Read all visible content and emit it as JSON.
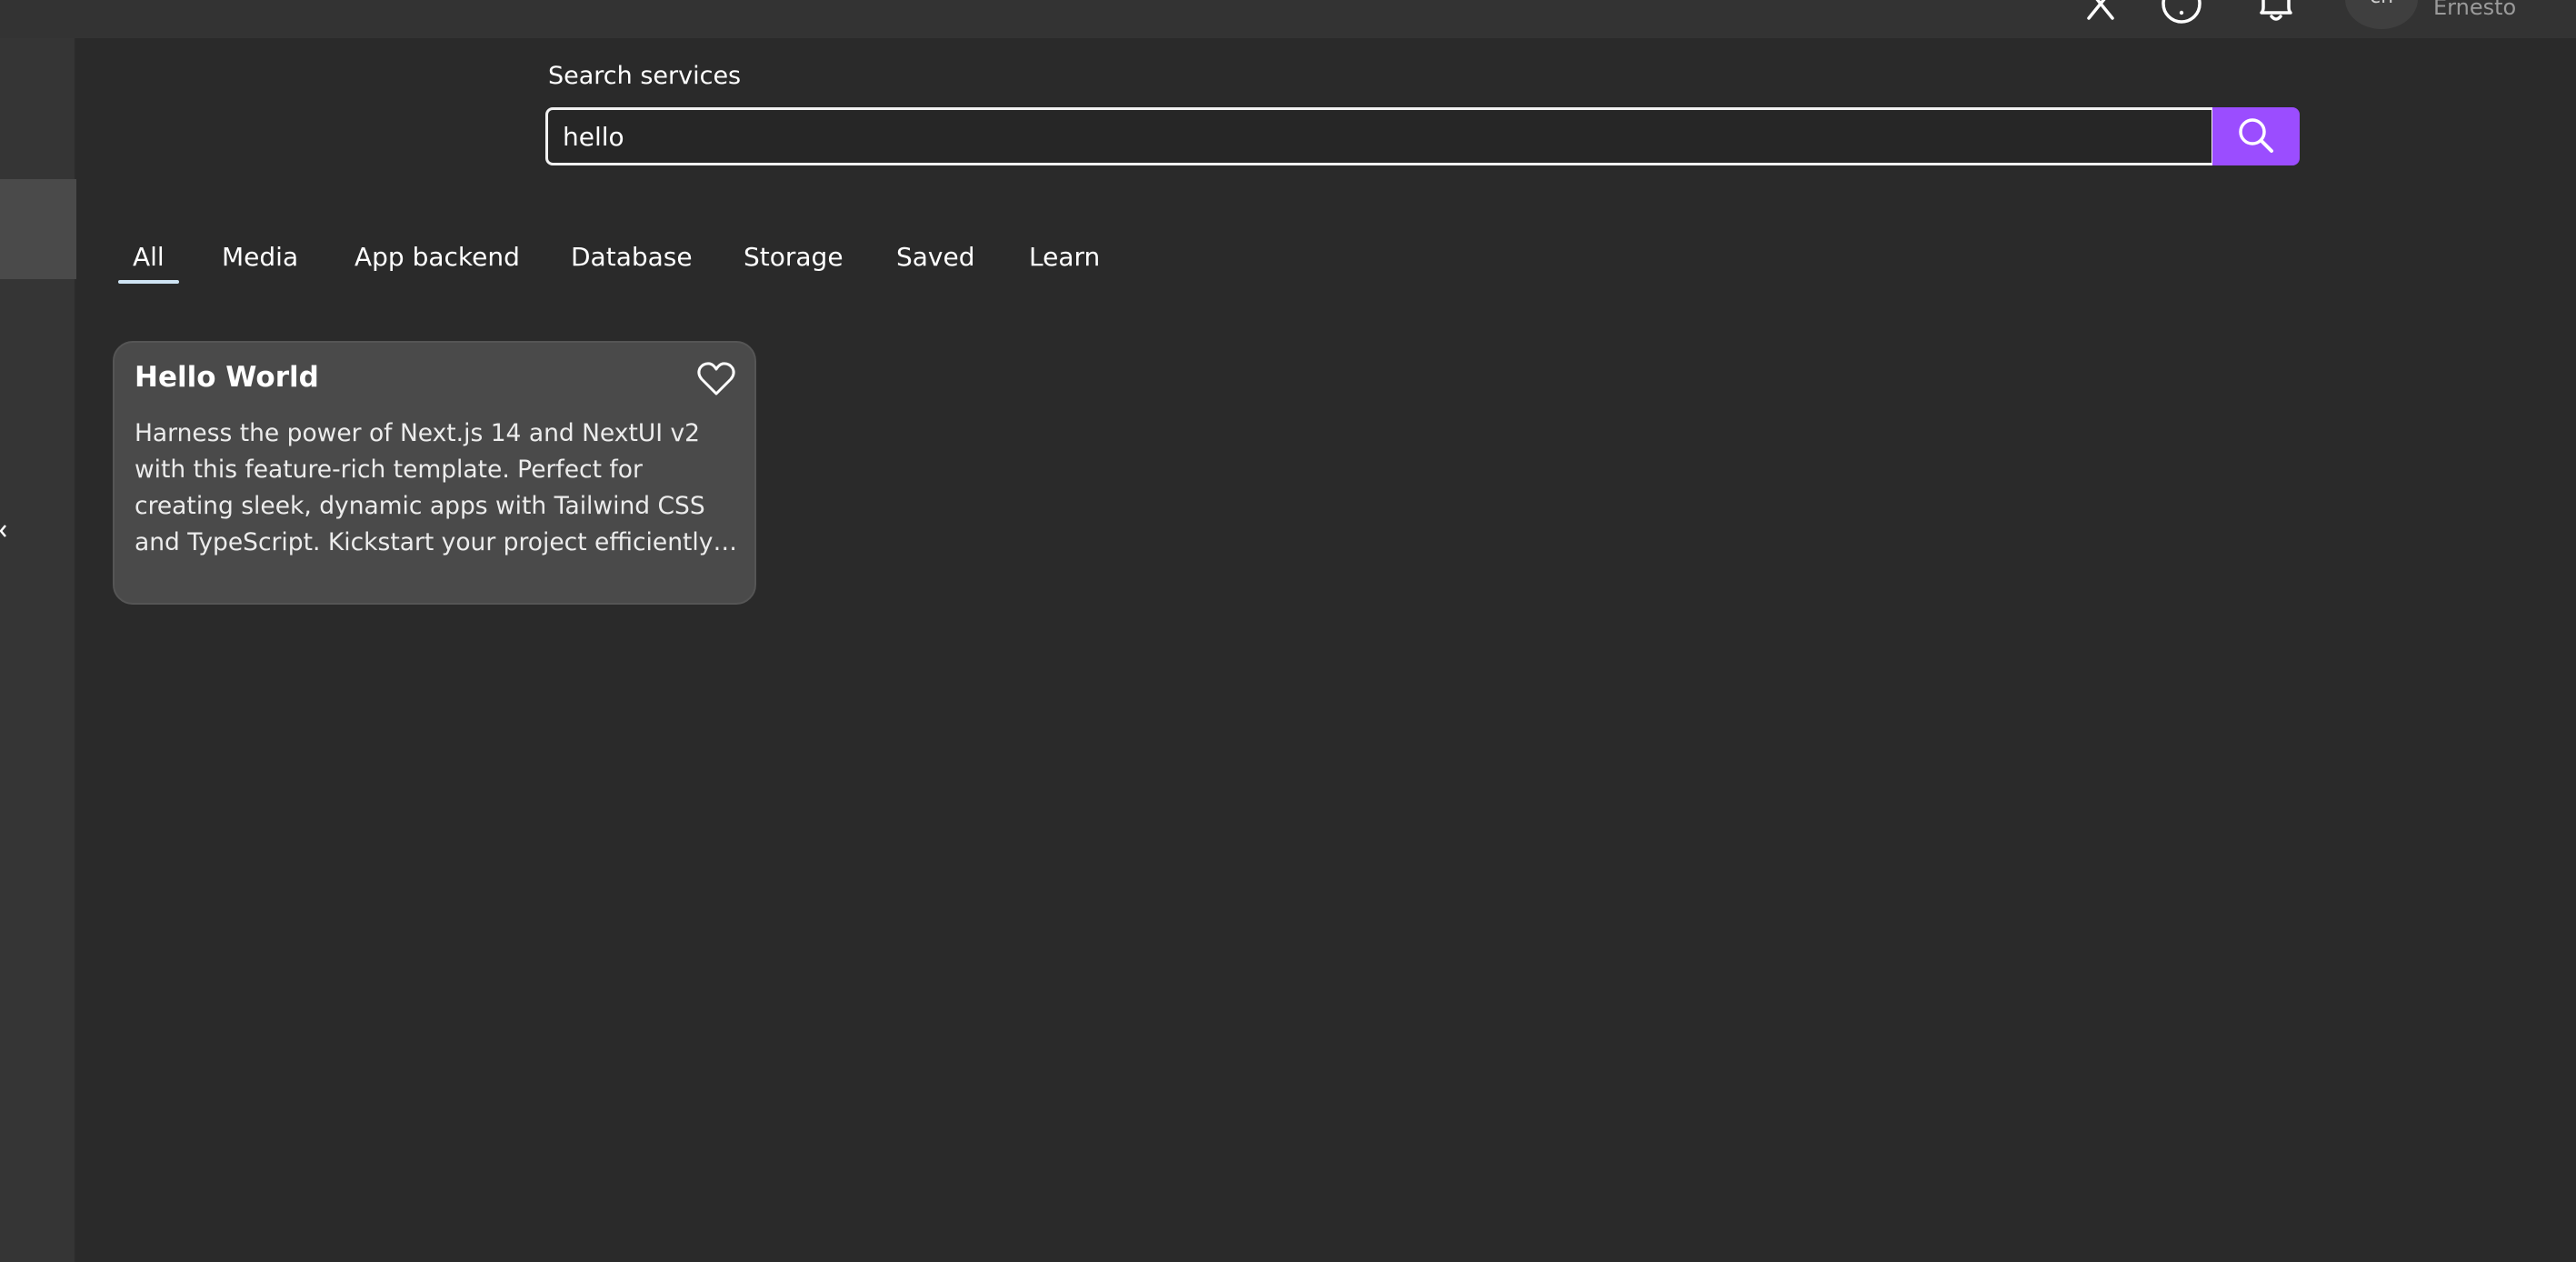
{
  "header": {
    "avatar_initials": "cn",
    "user_name": "Ernesto",
    "icons": [
      "close-icon",
      "help-icon",
      "bell-icon"
    ]
  },
  "sidebar": {
    "icons": [
      "chevron-left-icon"
    ]
  },
  "search": {
    "label": "Search services",
    "value": "hello",
    "button_icon": "search-icon"
  },
  "tabs": [
    {
      "label": "All",
      "active": true
    },
    {
      "label": "Media",
      "active": false
    },
    {
      "label": "App backend",
      "active": false
    },
    {
      "label": "Database",
      "active": false
    },
    {
      "label": "Storage",
      "active": false
    },
    {
      "label": "Saved",
      "active": false
    },
    {
      "label": "Learn",
      "active": false
    }
  ],
  "results": [
    {
      "title": "Hello World",
      "description": "Harness the power of Next.js 14 and NextUI v2 with this feature-rich template. Perfect for creating sleek, dynamic apps with Tailwind CSS and TypeScript. Kickstart your project efficiently with pre-built components and a modern stack.",
      "favorite_icon": "heart-outline-icon"
    }
  ],
  "colors": {
    "background": "#2a2a2a",
    "topbar": "#333333",
    "sidebar": "#353535",
    "accent": "#9b4dff",
    "card": "#4a4a4a",
    "tab_indicator": "#cfe4f4"
  }
}
